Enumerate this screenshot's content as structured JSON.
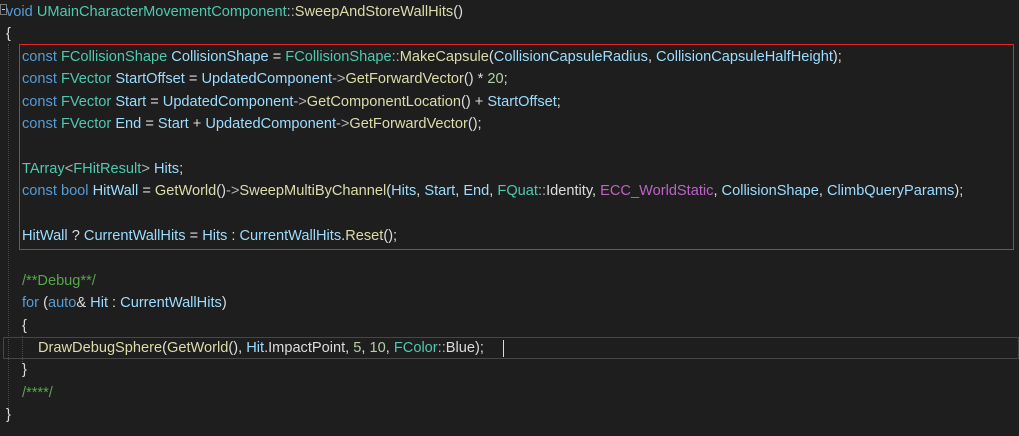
{
  "editor": {
    "lines": [
      [
        [
          "kw",
          "void"
        ],
        [
          "pl",
          " "
        ],
        [
          "ty",
          "UMainCharacterMovementComponent"
        ],
        [
          "op",
          "::"
        ],
        [
          "fn",
          "SweepAndStoreWallHits"
        ],
        [
          "pl",
          "()"
        ]
      ],
      [
        [
          "pl",
          "{"
        ]
      ],
      [
        [
          "kw",
          "const"
        ],
        [
          "pl",
          " "
        ],
        [
          "ty",
          "FCollisionShape"
        ],
        [
          "pl",
          " "
        ],
        [
          "var",
          "CollisionShape"
        ],
        [
          "pl",
          " = "
        ],
        [
          "ty",
          "FCollisionShape"
        ],
        [
          "op",
          "::"
        ],
        [
          "fn",
          "MakeCapsule"
        ],
        [
          "pl",
          "("
        ],
        [
          "var",
          "CollisionCapsuleRadius"
        ],
        [
          "pl",
          ", "
        ],
        [
          "var",
          "CollisionCapsuleHalfHeight"
        ],
        [
          "pl",
          ");"
        ]
      ],
      [
        [
          "kw",
          "const"
        ],
        [
          "pl",
          " "
        ],
        [
          "ty",
          "FVector"
        ],
        [
          "pl",
          " "
        ],
        [
          "var",
          "StartOffset"
        ],
        [
          "pl",
          " = "
        ],
        [
          "var",
          "UpdatedComponent"
        ],
        [
          "op",
          "->"
        ],
        [
          "fn",
          "GetForwardVector"
        ],
        [
          "pl",
          "() * "
        ],
        [
          "num",
          "20"
        ],
        [
          "pl",
          ";"
        ]
      ],
      [
        [
          "kw",
          "const"
        ],
        [
          "pl",
          " "
        ],
        [
          "ty",
          "FVector"
        ],
        [
          "pl",
          " "
        ],
        [
          "var",
          "Start"
        ],
        [
          "pl",
          " = "
        ],
        [
          "var",
          "UpdatedComponent"
        ],
        [
          "op",
          "->"
        ],
        [
          "fn",
          "GetComponentLocation"
        ],
        [
          "pl",
          "() + "
        ],
        [
          "var",
          "StartOffset"
        ],
        [
          "pl",
          ";"
        ]
      ],
      [
        [
          "kw",
          "const"
        ],
        [
          "pl",
          " "
        ],
        [
          "ty",
          "FVector"
        ],
        [
          "pl",
          " "
        ],
        [
          "var",
          "End"
        ],
        [
          "pl",
          " = "
        ],
        [
          "var",
          "Start"
        ],
        [
          "pl",
          " + "
        ],
        [
          "var",
          "UpdatedComponent"
        ],
        [
          "op",
          "->"
        ],
        [
          "fn",
          "GetForwardVector"
        ],
        [
          "pl",
          "();"
        ]
      ],
      [],
      [
        [
          "ty",
          "TArray"
        ],
        [
          "op",
          "<"
        ],
        [
          "ty",
          "FHitResult"
        ],
        [
          "op",
          ">"
        ],
        [
          "pl",
          " "
        ],
        [
          "var",
          "Hits"
        ],
        [
          "pl",
          ";"
        ]
      ],
      [
        [
          "kw",
          "const"
        ],
        [
          "pl",
          " "
        ],
        [
          "kw",
          "bool"
        ],
        [
          "pl",
          " "
        ],
        [
          "var",
          "HitWall"
        ],
        [
          "pl",
          " = "
        ],
        [
          "fn",
          "GetWorld"
        ],
        [
          "pl",
          "()"
        ],
        [
          "op",
          "->"
        ],
        [
          "fn",
          "SweepMultiByChannel"
        ],
        [
          "pl",
          "("
        ],
        [
          "var",
          "Hits"
        ],
        [
          "pl",
          ", "
        ],
        [
          "var",
          "Start"
        ],
        [
          "pl",
          ", "
        ],
        [
          "var",
          "End"
        ],
        [
          "pl",
          ", "
        ],
        [
          "ty",
          "FQuat"
        ],
        [
          "op",
          "::"
        ],
        [
          "pl",
          "Identity, "
        ],
        [
          "mc",
          "ECC_WorldStatic"
        ],
        [
          "pl",
          ", "
        ],
        [
          "var",
          "CollisionShape"
        ],
        [
          "pl",
          ", "
        ],
        [
          "var",
          "ClimbQueryParams"
        ],
        [
          "pl",
          ");"
        ]
      ],
      [],
      [
        [
          "var",
          "HitWall"
        ],
        [
          "pl",
          " ? "
        ],
        [
          "var",
          "CurrentWallHits"
        ],
        [
          "pl",
          " = "
        ],
        [
          "var",
          "Hits"
        ],
        [
          "pl",
          " : "
        ],
        [
          "var",
          "CurrentWallHits"
        ],
        [
          "pl",
          "."
        ],
        [
          "fn",
          "Reset"
        ],
        [
          "pl",
          "();"
        ]
      ],
      [],
      [
        [
          "cm",
          "/**Debug**/"
        ]
      ],
      [
        [
          "kw",
          "for"
        ],
        [
          "pl",
          " ("
        ],
        [
          "kw",
          "auto"
        ],
        [
          "pl",
          "& "
        ],
        [
          "var",
          "Hit"
        ],
        [
          "pl",
          " : "
        ],
        [
          "var",
          "CurrentWallHits"
        ],
        [
          "pl",
          ")"
        ]
      ],
      [
        [
          "pl",
          "{"
        ]
      ],
      [
        [
          "fn",
          "DrawDebugSphere"
        ],
        [
          "pl",
          "("
        ],
        [
          "fn",
          "GetWorld"
        ],
        [
          "pl",
          "(), "
        ],
        [
          "var",
          "Hit"
        ],
        [
          "pl",
          ".ImpactPoint, "
        ],
        [
          "num",
          "5"
        ],
        [
          "pl",
          ", "
        ],
        [
          "num",
          "10"
        ],
        [
          "pl",
          ", "
        ],
        [
          "ty",
          "FColor"
        ],
        [
          "op",
          "::"
        ],
        [
          "pl",
          "Blue);"
        ]
      ],
      [
        [
          "pl",
          "}"
        ]
      ],
      [
        [
          "cm",
          "/****/"
        ]
      ],
      [
        [
          "pl",
          "}"
        ]
      ]
    ]
  }
}
